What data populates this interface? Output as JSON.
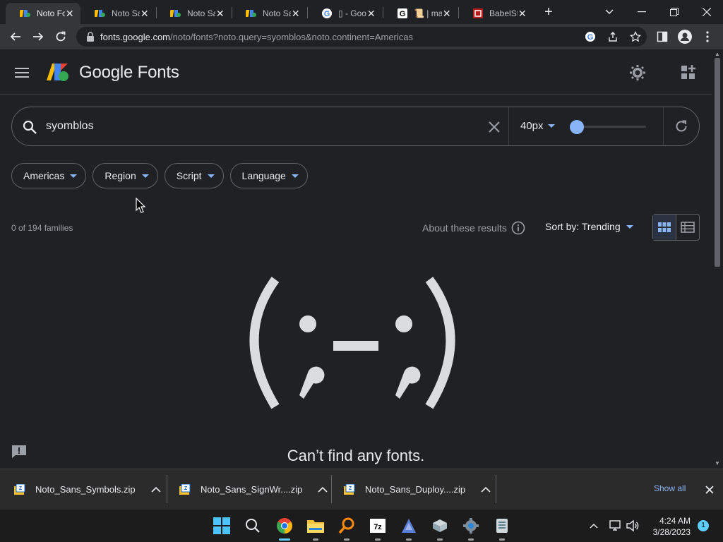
{
  "browser": {
    "tabs": [
      {
        "title": "Noto Fo",
        "favicon": "google-fonts-favicon",
        "active": true
      },
      {
        "title": "Noto Sa",
        "favicon": "google-fonts-favicon",
        "active": false
      },
      {
        "title": "Noto Sa",
        "favicon": "google-fonts-favicon",
        "active": false
      },
      {
        "title": "Noto Sa",
        "favicon": "google-fonts-favicon",
        "active": false
      },
      {
        "title": "▯ - Goo",
        "favicon": "google-favicon",
        "active": false
      },
      {
        "title": "📜 | may",
        "favicon": "g-favicon",
        "active": false
      },
      {
        "title": "BabelSt",
        "favicon": "babelstone-favicon",
        "active": false
      }
    ],
    "url_host": "fonts.google.com",
    "url_path": "/noto/fonts?noto.query=syomblos&noto.continent=Americas"
  },
  "header": {
    "title": "Google Fonts"
  },
  "search": {
    "query": "syomblos",
    "font_size": "40px",
    "size_level": 0.1
  },
  "filters": [
    {
      "label": "Americas"
    },
    {
      "label": "Region"
    },
    {
      "label": "Script"
    },
    {
      "label": "Language"
    }
  ],
  "results": {
    "count": "0 of 194 families",
    "about": "About these results",
    "sort": "Sort by: Trending"
  },
  "empty_state": {
    "emoticon": "(;-;)",
    "message": "Can’t find any fonts."
  },
  "downloads": {
    "items": [
      {
        "name": "Noto_Sans_Symbols.zip"
      },
      {
        "name": "Noto_Sans_SignWr....zip"
      },
      {
        "name": "Noto_Sans_Duploy....zip"
      }
    ],
    "show_all": "Show all"
  },
  "taskbar": {
    "time": "4:24 AM",
    "date": "3/28/2023",
    "notifications": "1"
  },
  "colors": {
    "accent": "#8ab4f8",
    "background": "#202124",
    "text": "#e8eaed"
  }
}
